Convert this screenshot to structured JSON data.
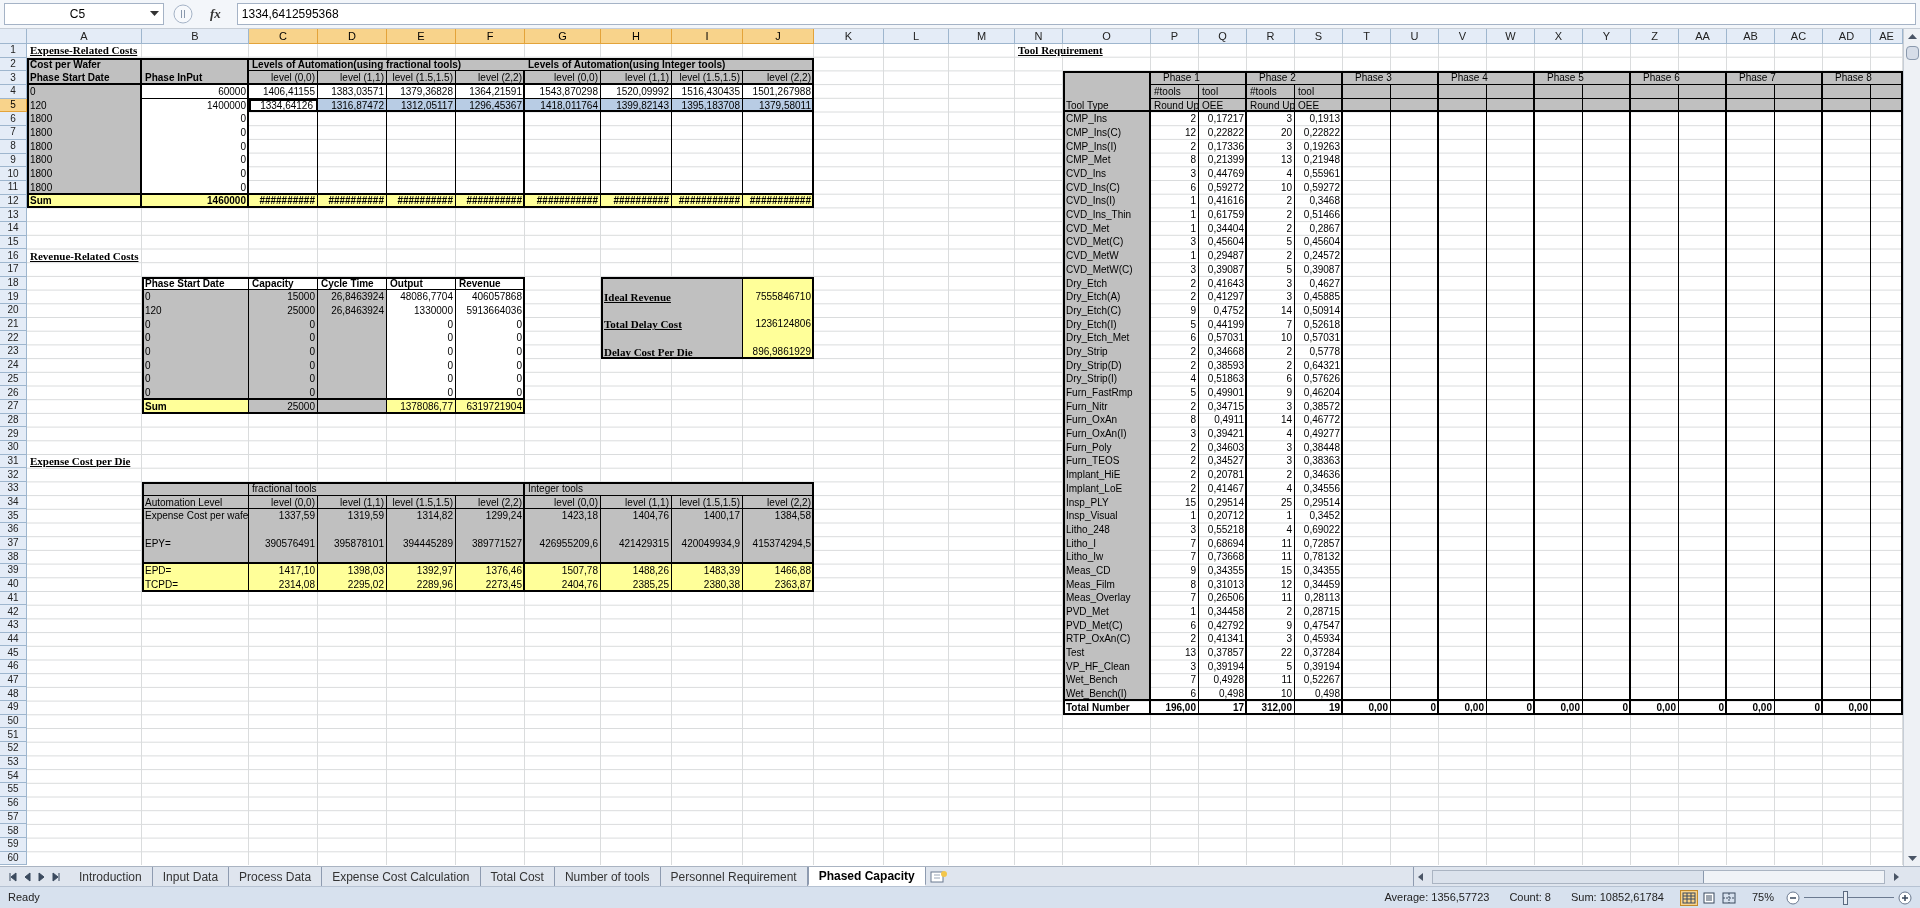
{
  "formula_bar": {
    "name_box": "C5",
    "function_label": "fx",
    "formula": "1334,6412595368"
  },
  "column_headers": [
    {
      "label": "A",
      "selected": false
    },
    {
      "label": "B",
      "selected": false
    },
    {
      "label": "C",
      "selected": true
    },
    {
      "label": "D",
      "selected": true
    },
    {
      "label": "E",
      "selected": true
    },
    {
      "label": "F",
      "selected": true
    },
    {
      "label": "G",
      "selected": true
    },
    {
      "label": "H",
      "selected": true
    },
    {
      "label": "I",
      "selected": true
    },
    {
      "label": "J",
      "selected": true
    },
    {
      "label": "K",
      "selected": false
    },
    {
      "label": "L",
      "selected": false
    },
    {
      "label": "M",
      "selected": false
    },
    {
      "label": "N",
      "selected": false
    },
    {
      "label": "O",
      "selected": false
    },
    {
      "label": "P",
      "selected": false
    },
    {
      "label": "Q",
      "selected": false
    },
    {
      "label": "R",
      "selected": false
    },
    {
      "label": "S",
      "selected": false
    },
    {
      "label": "T",
      "selected": false
    },
    {
      "label": "U",
      "selected": false
    },
    {
      "label": "V",
      "selected": false
    },
    {
      "label": "W",
      "selected": false
    },
    {
      "label": "X",
      "selected": false
    },
    {
      "label": "Y",
      "selected": false
    },
    {
      "label": "Z",
      "selected": false
    },
    {
      "label": "AA",
      "selected": false
    },
    {
      "label": "AB",
      "selected": false
    },
    {
      "label": "AC",
      "selected": false
    },
    {
      "label": "AD",
      "selected": false
    },
    {
      "label": "AE",
      "selected": false
    }
  ],
  "row_headers": [
    {
      "label": "1",
      "selected": false
    },
    {
      "label": "2",
      "selected": false
    },
    {
      "label": "3",
      "selected": false
    },
    {
      "label": "4",
      "selected": false
    },
    {
      "label": "5",
      "selected": true
    },
    {
      "label": "6",
      "selected": false
    },
    {
      "label": "7",
      "selected": false
    },
    {
      "label": "8",
      "selected": false
    },
    {
      "label": "9",
      "selected": false
    },
    {
      "label": "10",
      "selected": false
    },
    {
      "label": "11",
      "selected": false
    },
    {
      "label": "12",
      "selected": false
    },
    {
      "label": "13",
      "selected": false
    },
    {
      "label": "14",
      "selected": false
    },
    {
      "label": "15",
      "selected": false
    },
    {
      "label": "16",
      "selected": false
    },
    {
      "label": "17",
      "selected": false
    },
    {
      "label": "18",
      "selected": false
    },
    {
      "label": "19",
      "selected": false
    },
    {
      "label": "20",
      "selected": false
    },
    {
      "label": "21",
      "selected": false
    },
    {
      "label": "22",
      "selected": false
    },
    {
      "label": "23",
      "selected": false
    },
    {
      "label": "24",
      "selected": false
    },
    {
      "label": "25",
      "selected": false
    },
    {
      "label": "26",
      "selected": false
    },
    {
      "label": "27",
      "selected": false
    },
    {
      "label": "28",
      "selected": false
    },
    {
      "label": "29",
      "selected": false
    },
    {
      "label": "30",
      "selected": false
    },
    {
      "label": "31",
      "selected": false
    },
    {
      "label": "32",
      "selected": false
    },
    {
      "label": "33",
      "selected": false
    },
    {
      "label": "34",
      "selected": false
    },
    {
      "label": "35",
      "selected": false
    },
    {
      "label": "36",
      "selected": false
    },
    {
      "label": "37",
      "selected": false
    },
    {
      "label": "38",
      "selected": false
    },
    {
      "label": "39",
      "selected": false
    },
    {
      "label": "40",
      "selected": false
    },
    {
      "label": "41",
      "selected": false
    },
    {
      "label": "42",
      "selected": false
    },
    {
      "label": "43",
      "selected": false
    },
    {
      "label": "44",
      "selected": false
    },
    {
      "label": "45",
      "selected": false
    },
    {
      "label": "46",
      "selected": false
    },
    {
      "label": "47",
      "selected": false
    },
    {
      "label": "48",
      "selected": false
    },
    {
      "label": "49",
      "selected": false
    },
    {
      "label": "50",
      "selected": false
    },
    {
      "label": "51",
      "selected": false
    },
    {
      "label": "52",
      "selected": false
    },
    {
      "label": "53",
      "selected": false
    },
    {
      "label": "54",
      "selected": false
    },
    {
      "label": "55",
      "selected": false
    },
    {
      "label": "56",
      "selected": false
    },
    {
      "label": "57",
      "selected": false
    },
    {
      "label": "58",
      "selected": false
    },
    {
      "label": "59",
      "selected": false
    },
    {
      "label": "60",
      "selected": false
    }
  ],
  "expense_related_costs": {
    "title": "Expense-Related Costs",
    "corner": "Cost per Wafer",
    "groups": [
      "Levels of Automation(using fractional tools)",
      "Levels of Automation(using Integer tools)"
    ],
    "headers": [
      "Phase Start Date",
      "Phase InPut",
      "level (0,0)",
      "level (1,1)",
      "level (1.5,1.5)",
      "level (2,2)",
      "level (0,0)",
      "level (1,1)",
      "level (1.5,1.5)",
      "level (2,2)"
    ],
    "rows": [
      {
        "cells": [
          "0",
          "60000",
          "1406,41155",
          "1383,03571",
          "1379,36828",
          "1364,21591",
          "1543,870298",
          "1520,09992",
          "1516,430435",
          "1501,267988"
        ],
        "selected": false
      },
      {
        "cells": [
          "120",
          "1400000",
          "1334,64126",
          "1316,87472",
          "1312,05117",
          "1296,45367",
          "1418,011764",
          "1399,82143",
          "1395,183708",
          "1379,58011"
        ],
        "selected": true
      },
      {
        "cells": [
          "1800",
          "0"
        ],
        "selected": false
      },
      {
        "cells": [
          "1800",
          "0"
        ],
        "selected": false
      },
      {
        "cells": [
          "1800",
          "0"
        ],
        "selected": false
      },
      {
        "cells": [
          "1800",
          "0"
        ],
        "selected": false
      },
      {
        "cells": [
          "1800",
          "0"
        ],
        "selected": false
      },
      {
        "cells": [
          "1800",
          "0"
        ],
        "selected": false
      }
    ],
    "sum": [
      "Sum",
      "1460000",
      "##########",
      "##########",
      "##########",
      "##########",
      "###########",
      "##########",
      "###########",
      "###########"
    ]
  },
  "revenue_related_costs": {
    "title": "Revenue-Related Costs",
    "headers": [
      "Phase Start Date",
      "Capacity",
      "Cycle Time",
      "Output",
      "Revenue"
    ],
    "rows": [
      {
        "phase_start_date": "0",
        "capacity": "15000",
        "cycle_time": "26,8463924",
        "output": "48086,7704",
        "revenue": "406057868"
      },
      {
        "phase_start_date": "120",
        "capacity": "25000",
        "cycle_time": "26,8463924",
        "output": "1330000",
        "revenue": "5913664036"
      },
      {
        "phase_start_date": "0",
        "capacity": "0",
        "output": "0",
        "revenue": "0"
      },
      {
        "phase_start_date": "0",
        "capacity": "0",
        "output": "0",
        "revenue": "0"
      },
      {
        "phase_start_date": "0",
        "capacity": "0",
        "output": "0",
        "revenue": "0"
      },
      {
        "phase_start_date": "0",
        "capacity": "0",
        "output": "0",
        "revenue": "0"
      },
      {
        "phase_start_date": "0",
        "capacity": "0",
        "output": "0",
        "revenue": "0"
      },
      {
        "phase_start_date": "0",
        "capacity": "0",
        "output": "0",
        "revenue": "0"
      }
    ],
    "sum": {
      "label": "Sum",
      "capacity": "25000",
      "output": "1378086,77",
      "revenue": "6319721904"
    }
  },
  "revenue_summary": [
    {
      "label": "Ideal Revenue",
      "value": "7555846710"
    },
    {
      "label": "Total Delay Cost",
      "value": "1236124806"
    },
    {
      "label": "Delay Cost Per Die",
      "value": "896,9861929"
    }
  ],
  "expense_cost_per_die": {
    "title": "Expense Cost per Die",
    "groups": [
      "fractional tools",
      "Integer tools"
    ],
    "rows": [
      {
        "kind": "heading",
        "label": "Automation Level",
        "values": [
          "level (0,0)",
          "level (1,1)",
          "level (1.5,1.5)",
          "level (2,2)",
          "level (0,0)",
          "level (1,1)",
          "level (1.5,1.5)",
          "level (2,2)"
        ]
      },
      {
        "kind": "input",
        "label": "Expense Cost per wafe",
        "values": [
          "1337,59",
          "1319,59",
          "1314,82",
          "1299,24",
          "1423,18",
          "1404,76",
          "1400,17",
          "1384,58"
        ]
      },
      {
        "kind": "input",
        "label": "EPY=",
        "values": [
          "390576491",
          "395878101",
          "394445289",
          "389771527",
          "426955209,6",
          "421429315",
          "420049934,9",
          "415374294,5"
        ]
      },
      {
        "kind": "result",
        "label": "EPD=",
        "values": [
          "1417,10",
          "1398,03",
          "1392,97",
          "1376,46",
          "1507,78",
          "1488,26",
          "1483,39",
          "1466,88"
        ]
      },
      {
        "kind": "result",
        "label": "TCPD=",
        "values": [
          "2314,08",
          "2295,02",
          "2289,96",
          "2273,45",
          "2404,76",
          "2385,25",
          "2380,38",
          "2363,87"
        ]
      }
    ]
  },
  "tool_requirement": {
    "title": "Tool Requirement",
    "type_header": "Tool Type",
    "phases": [
      "Phase 1",
      "Phase 2",
      "Phase 3",
      "Phase 4",
      "Phase 5",
      "Phase 6",
      "Phase 7",
      "Phase 8"
    ],
    "subheaders": [
      {
        "top": "#tools",
        "bottom": "Round Up"
      },
      {
        "top": "tool",
        "bottom": "OEE"
      },
      {
        "top": "#tools",
        "bottom": "Round Up"
      },
      {
        "top": "tool",
        "bottom": "OEE"
      }
    ],
    "tools": [
      {
        "name": "CMP_Ins",
        "values": [
          "2",
          "0,17217",
          "3",
          "0,1913"
        ]
      },
      {
        "name": "CMP_Ins(C)",
        "values": [
          "12",
          "0,22822",
          "20",
          "0,22822"
        ]
      },
      {
        "name": "CMP_Ins(I)",
        "values": [
          "2",
          "0,17336",
          "3",
          "0,19263"
        ]
      },
      {
        "name": "CMP_Met",
        "values": [
          "8",
          "0,21399",
          "13",
          "0,21948"
        ]
      },
      {
        "name": "CVD_Ins",
        "values": [
          "3",
          "0,44769",
          "4",
          "0,55961"
        ]
      },
      {
        "name": "CVD_Ins(C)",
        "values": [
          "6",
          "0,59272",
          "10",
          "0,59272"
        ]
      },
      {
        "name": "CVD_Ins(I)",
        "values": [
          "1",
          "0,41616",
          "2",
          "0,3468"
        ]
      },
      {
        "name": "CVD_Ins_Thin",
        "values": [
          "1",
          "0,61759",
          "2",
          "0,51466"
        ]
      },
      {
        "name": "CVD_Met",
        "values": [
          "1",
          "0,34404",
          "2",
          "0,2867"
        ]
      },
      {
        "name": "CVD_Met(C)",
        "values": [
          "3",
          "0,45604",
          "5",
          "0,45604"
        ]
      },
      {
        "name": "CVD_MetW",
        "values": [
          "1",
          "0,29487",
          "2",
          "0,24572"
        ]
      },
      {
        "name": "CVD_MetW(C)",
        "values": [
          "3",
          "0,39087",
          "5",
          "0,39087"
        ]
      },
      {
        "name": "Dry_Etch",
        "values": [
          "2",
          "0,41643",
          "3",
          "0,4627"
        ]
      },
      {
        "name": "Dry_Etch(A)",
        "values": [
          "2",
          "0,41297",
          "3",
          "0,45885"
        ]
      },
      {
        "name": "Dry_Etch(C)",
        "values": [
          "9",
          "0,4752",
          "14",
          "0,50914"
        ]
      },
      {
        "name": "Dry_Etch(I)",
        "values": [
          "5",
          "0,44199",
          "7",
          "0,52618"
        ]
      },
      {
        "name": "Dry_Etch_Met",
        "values": [
          "6",
          "0,57031",
          "10",
          "0,57031"
        ]
      },
      {
        "name": "Dry_Strip",
        "values": [
          "2",
          "0,34668",
          "2",
          "0,5778"
        ]
      },
      {
        "name": "Dry_Strip(D)",
        "values": [
          "2",
          "0,38593",
          "2",
          "0,64321"
        ]
      },
      {
        "name": "Dry_Strip(I)",
        "values": [
          "4",
          "0,51863",
          "6",
          "0,57626"
        ]
      },
      {
        "name": "Furn_FastRmp",
        "values": [
          "5",
          "0,49901",
          "9",
          "0,46204"
        ]
      },
      {
        "name": "Furn_Nitr",
        "values": [
          "2",
          "0,34715",
          "3",
          "0,38572"
        ]
      },
      {
        "name": "Furn_OxAn",
        "values": [
          "8",
          "0,4911",
          "14",
          "0,46772"
        ]
      },
      {
        "name": "Furn_OxAn(I)",
        "values": [
          "3",
          "0,39421",
          "4",
          "0,49277"
        ]
      },
      {
        "name": "Furn_Poly",
        "values": [
          "2",
          "0,34603",
          "3",
          "0,38448"
        ]
      },
      {
        "name": "Furn_TEOS",
        "values": [
          "2",
          "0,34527",
          "3",
          "0,38363"
        ]
      },
      {
        "name": "Implant_HiE",
        "values": [
          "2",
          "0,20781",
          "2",
          "0,34636"
        ]
      },
      {
        "name": "Implant_LoE",
        "values": [
          "2",
          "0,41467",
          "4",
          "0,34556"
        ]
      },
      {
        "name": "Insp_PLY",
        "values": [
          "15",
          "0,29514",
          "25",
          "0,29514"
        ]
      },
      {
        "name": "Insp_Visual",
        "values": [
          "1",
          "0,20712",
          "1",
          "0,3452"
        ]
      },
      {
        "name": "Litho_248",
        "values": [
          "3",
          "0,55218",
          "4",
          "0,69022"
        ]
      },
      {
        "name": "Litho_I",
        "values": [
          "7",
          "0,68694",
          "11",
          "0,72857"
        ]
      },
      {
        "name": "Litho_Iw",
        "values": [
          "7",
          "0,73668",
          "11",
          "0,78132"
        ]
      },
      {
        "name": "Meas_CD",
        "values": [
          "9",
          "0,34355",
          "15",
          "0,34355"
        ]
      },
      {
        "name": "Meas_Film",
        "values": [
          "8",
          "0,31013",
          "12",
          "0,34459"
        ]
      },
      {
        "name": "Meas_Overlay",
        "values": [
          "7",
          "0,26506",
          "11",
          "0,28113"
        ]
      },
      {
        "name": "PVD_Met",
        "values": [
          "1",
          "0,34458",
          "2",
          "0,28715"
        ]
      },
      {
        "name": "PVD_Met(C)",
        "values": [
          "6",
          "0,42792",
          "9",
          "0,47547"
        ]
      },
      {
        "name": "RTP_OxAn(C)",
        "values": [
          "2",
          "0,41341",
          "3",
          "0,45934"
        ]
      },
      {
        "name": "Test",
        "values": [
          "13",
          "0,37857",
          "22",
          "0,37284"
        ]
      },
      {
        "name": "VP_HF_Clean",
        "values": [
          "3",
          "0,39194",
          "5",
          "0,39194"
        ]
      },
      {
        "name": "Wet_Bench",
        "values": [
          "7",
          "0,4928",
          "11",
          "0,52267"
        ]
      },
      {
        "name": "Wet_Bench(I)",
        "values": [
          "6",
          "0,498",
          "10",
          "0,498"
        ]
      }
    ],
    "total": {
      "label": "Total Number",
      "values": [
        "196,00",
        "17",
        "312,00",
        "19",
        "0,00",
        "0",
        "0,00",
        "0",
        "0,00",
        "0",
        "0,00",
        "0",
        "0,00",
        "0",
        "0,00"
      ]
    }
  },
  "sheet_tabs": [
    {
      "label": "Introduction",
      "selected": false
    },
    {
      "label": "Input Data",
      "selected": false
    },
    {
      "label": "Process Data",
      "selected": false
    },
    {
      "label": "Expense Cost Calculation",
      "selected": false
    },
    {
      "label": "Total Cost",
      "selected": false
    },
    {
      "label": "Number of tools",
      "selected": false
    },
    {
      "label": "Personnel Requirement",
      "selected": false
    },
    {
      "label": "Phased Capacity",
      "selected": true
    }
  ],
  "status_bar": {
    "mode": "Ready",
    "average": "Average: 1356,57723",
    "count": "Count: 8",
    "sum": "Sum: 10852,61784",
    "views": [
      {
        "selected": true
      },
      {
        "selected": false
      },
      {
        "selected": false
      }
    ],
    "zoom": "75%",
    "zoom_slider": {
      "level": 0.45
    }
  }
}
